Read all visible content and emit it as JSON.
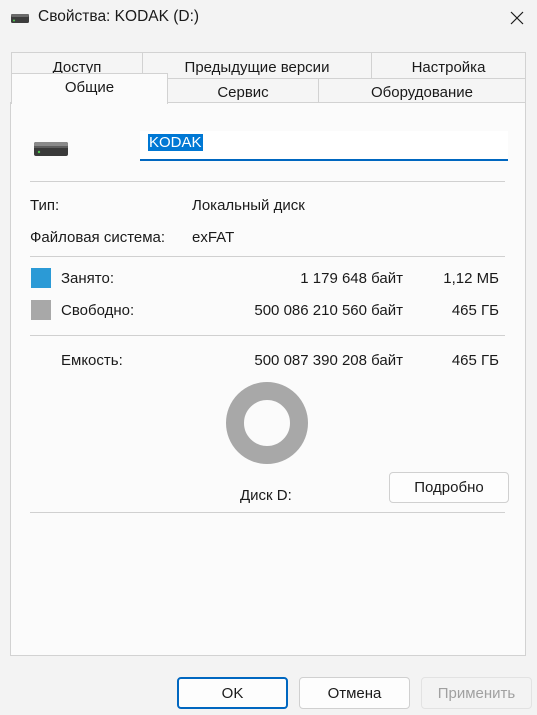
{
  "window": {
    "title": "Свойства: KODAK (D:)",
    "title_icon": "drive-icon",
    "close_icon": "close-icon"
  },
  "tabs_row1": [
    "Доступ",
    "Предыдущие версии",
    "Настройка"
  ],
  "tabs_row2": [
    "Общие",
    "Сервис",
    "Оборудование"
  ],
  "active_tab": "Общие",
  "general": {
    "drive_name": "KODAK",
    "type_label": "Тип:",
    "type_value": "Локальный диск",
    "fs_label": "Файловая система:",
    "fs_value": "exFAT",
    "used_label": "Занято:",
    "used_bytes": "1 179 648 байт",
    "used_short": "1,12 МБ",
    "free_label": "Свободно:",
    "free_bytes": "500 086 210 560 байт",
    "free_short": "465 ГБ",
    "capacity_label": "Емкость:",
    "capacity_bytes": "500 087 390 208 байт",
    "capacity_short": "465 ГБ",
    "disk_label": "Диск D:",
    "details_button": "Подробно",
    "used_fraction": 2.4e-06,
    "colors": {
      "used": "#2b9ad6",
      "free": "#a8a8a8"
    }
  },
  "buttons": {
    "ok": "OK",
    "cancel": "Отмена",
    "apply": "Применить"
  }
}
